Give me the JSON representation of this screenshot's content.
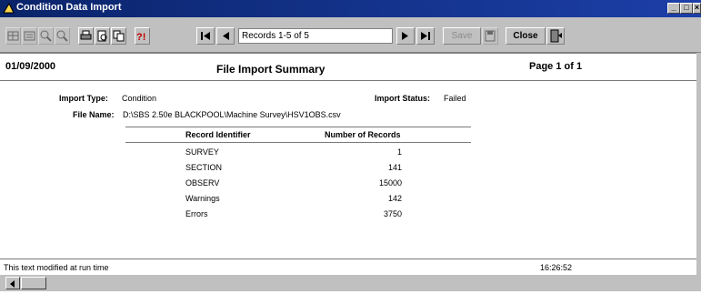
{
  "window": {
    "title": "Condition Data Import"
  },
  "toolbar": {
    "record_nav": "Records 1-5 of 5",
    "save_label": "Save",
    "close_label": "Close",
    "icons": [
      "grid-icon",
      "form-icon",
      "zoom-in-icon",
      "zoom-out-icon",
      "print-icon",
      "print-preview-icon",
      "copy-icon",
      "help-icon",
      "first-record-icon",
      "previous-record-icon",
      "next-record-icon",
      "last-record-icon",
      "save-icon",
      "close-door-icon"
    ]
  },
  "report": {
    "date": "01/09/2000",
    "title": "File Import Summary",
    "page": "Page 1 of 1",
    "import_type_label": "Import Type:",
    "import_type_value": "Condition",
    "import_status_label": "Import Status:",
    "import_status_value": "Failed",
    "file_name_label": "File Name:",
    "file_name_value": "D:\\SBS 2.50e BLACKPOOL\\Machine Survey\\HSV1OBS.csv",
    "columns": [
      "Record Identifier",
      "Number of Records"
    ],
    "rows": [
      {
        "id": "SURVEY",
        "count": "1"
      },
      {
        "id": "SECTION",
        "count": "141"
      },
      {
        "id": "OBSERV",
        "count": "15000"
      },
      {
        "id": "Warnings",
        "count": "142"
      },
      {
        "id": "Errors",
        "count": "3750"
      }
    ],
    "footer_text": "This text modified at run time",
    "footer_time": "16:26:52"
  }
}
